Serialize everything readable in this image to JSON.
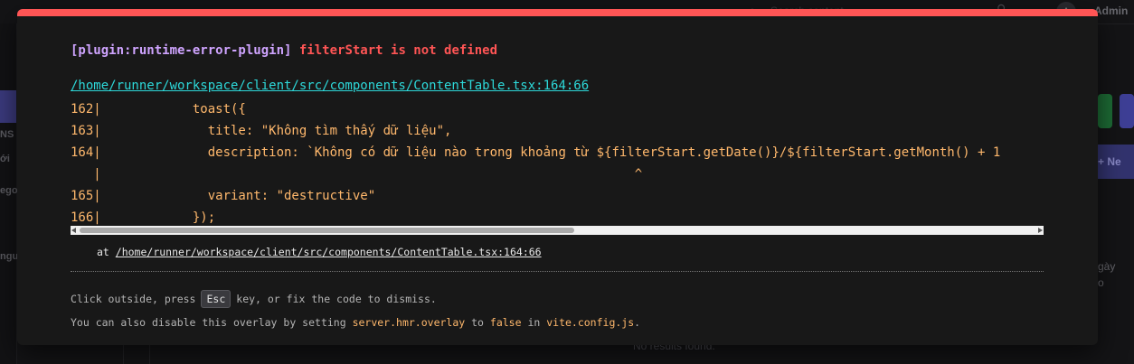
{
  "background_app": {
    "search_placeholder": "Search content...",
    "user_avatar_initial": "A",
    "user_name": "Admin",
    "sidebar_fragments": [
      "NS",
      "ới",
      "ego",
      "ngu"
    ],
    "new_button_label": "+ Ne",
    "column_fragments": [
      "gày",
      "o"
    ],
    "empty_state": "No results found."
  },
  "overlay": {
    "plugin": "[plugin:runtime-error-plugin]",
    "message": "filterStart is not defined",
    "file": "/home/runner/workspace/client/src/components/ContentTable.tsx:164:66",
    "frame_lines": [
      "162|            toast({",
      "163|              title: \"Không tìm thấy dữ liệu\",",
      "164|              description: `Không có dữ liệu nào trong khoảng từ ${filterStart.getDate()}/${filterStart.getMonth() + 1",
      "   |                                                                      ^",
      "165|              variant: \"destructive\"",
      "166|            });"
    ],
    "stack_prefix": "at ",
    "stack_file": "/home/runner/workspace/client/src/components/ContentTable.tsx:164:66",
    "tip_part1": "Click outside, press",
    "tip_key": "Esc",
    "tip_part2": "key, or fix the code to dismiss.",
    "tip2_a": "You can also disable this overlay by setting ",
    "tip2_config_key": "server.hmr.overlay",
    "tip2_b": " to ",
    "tip2_value": "false",
    "tip2_c": " in ",
    "tip2_file": "vite.config.js",
    "tip2_d": "."
  },
  "colors": {
    "overlay_border": "#ff5555",
    "plugin": "#cfa4ff",
    "message": "#ff5555",
    "file_link": "#2dd9da",
    "code": "#ffb86c"
  }
}
